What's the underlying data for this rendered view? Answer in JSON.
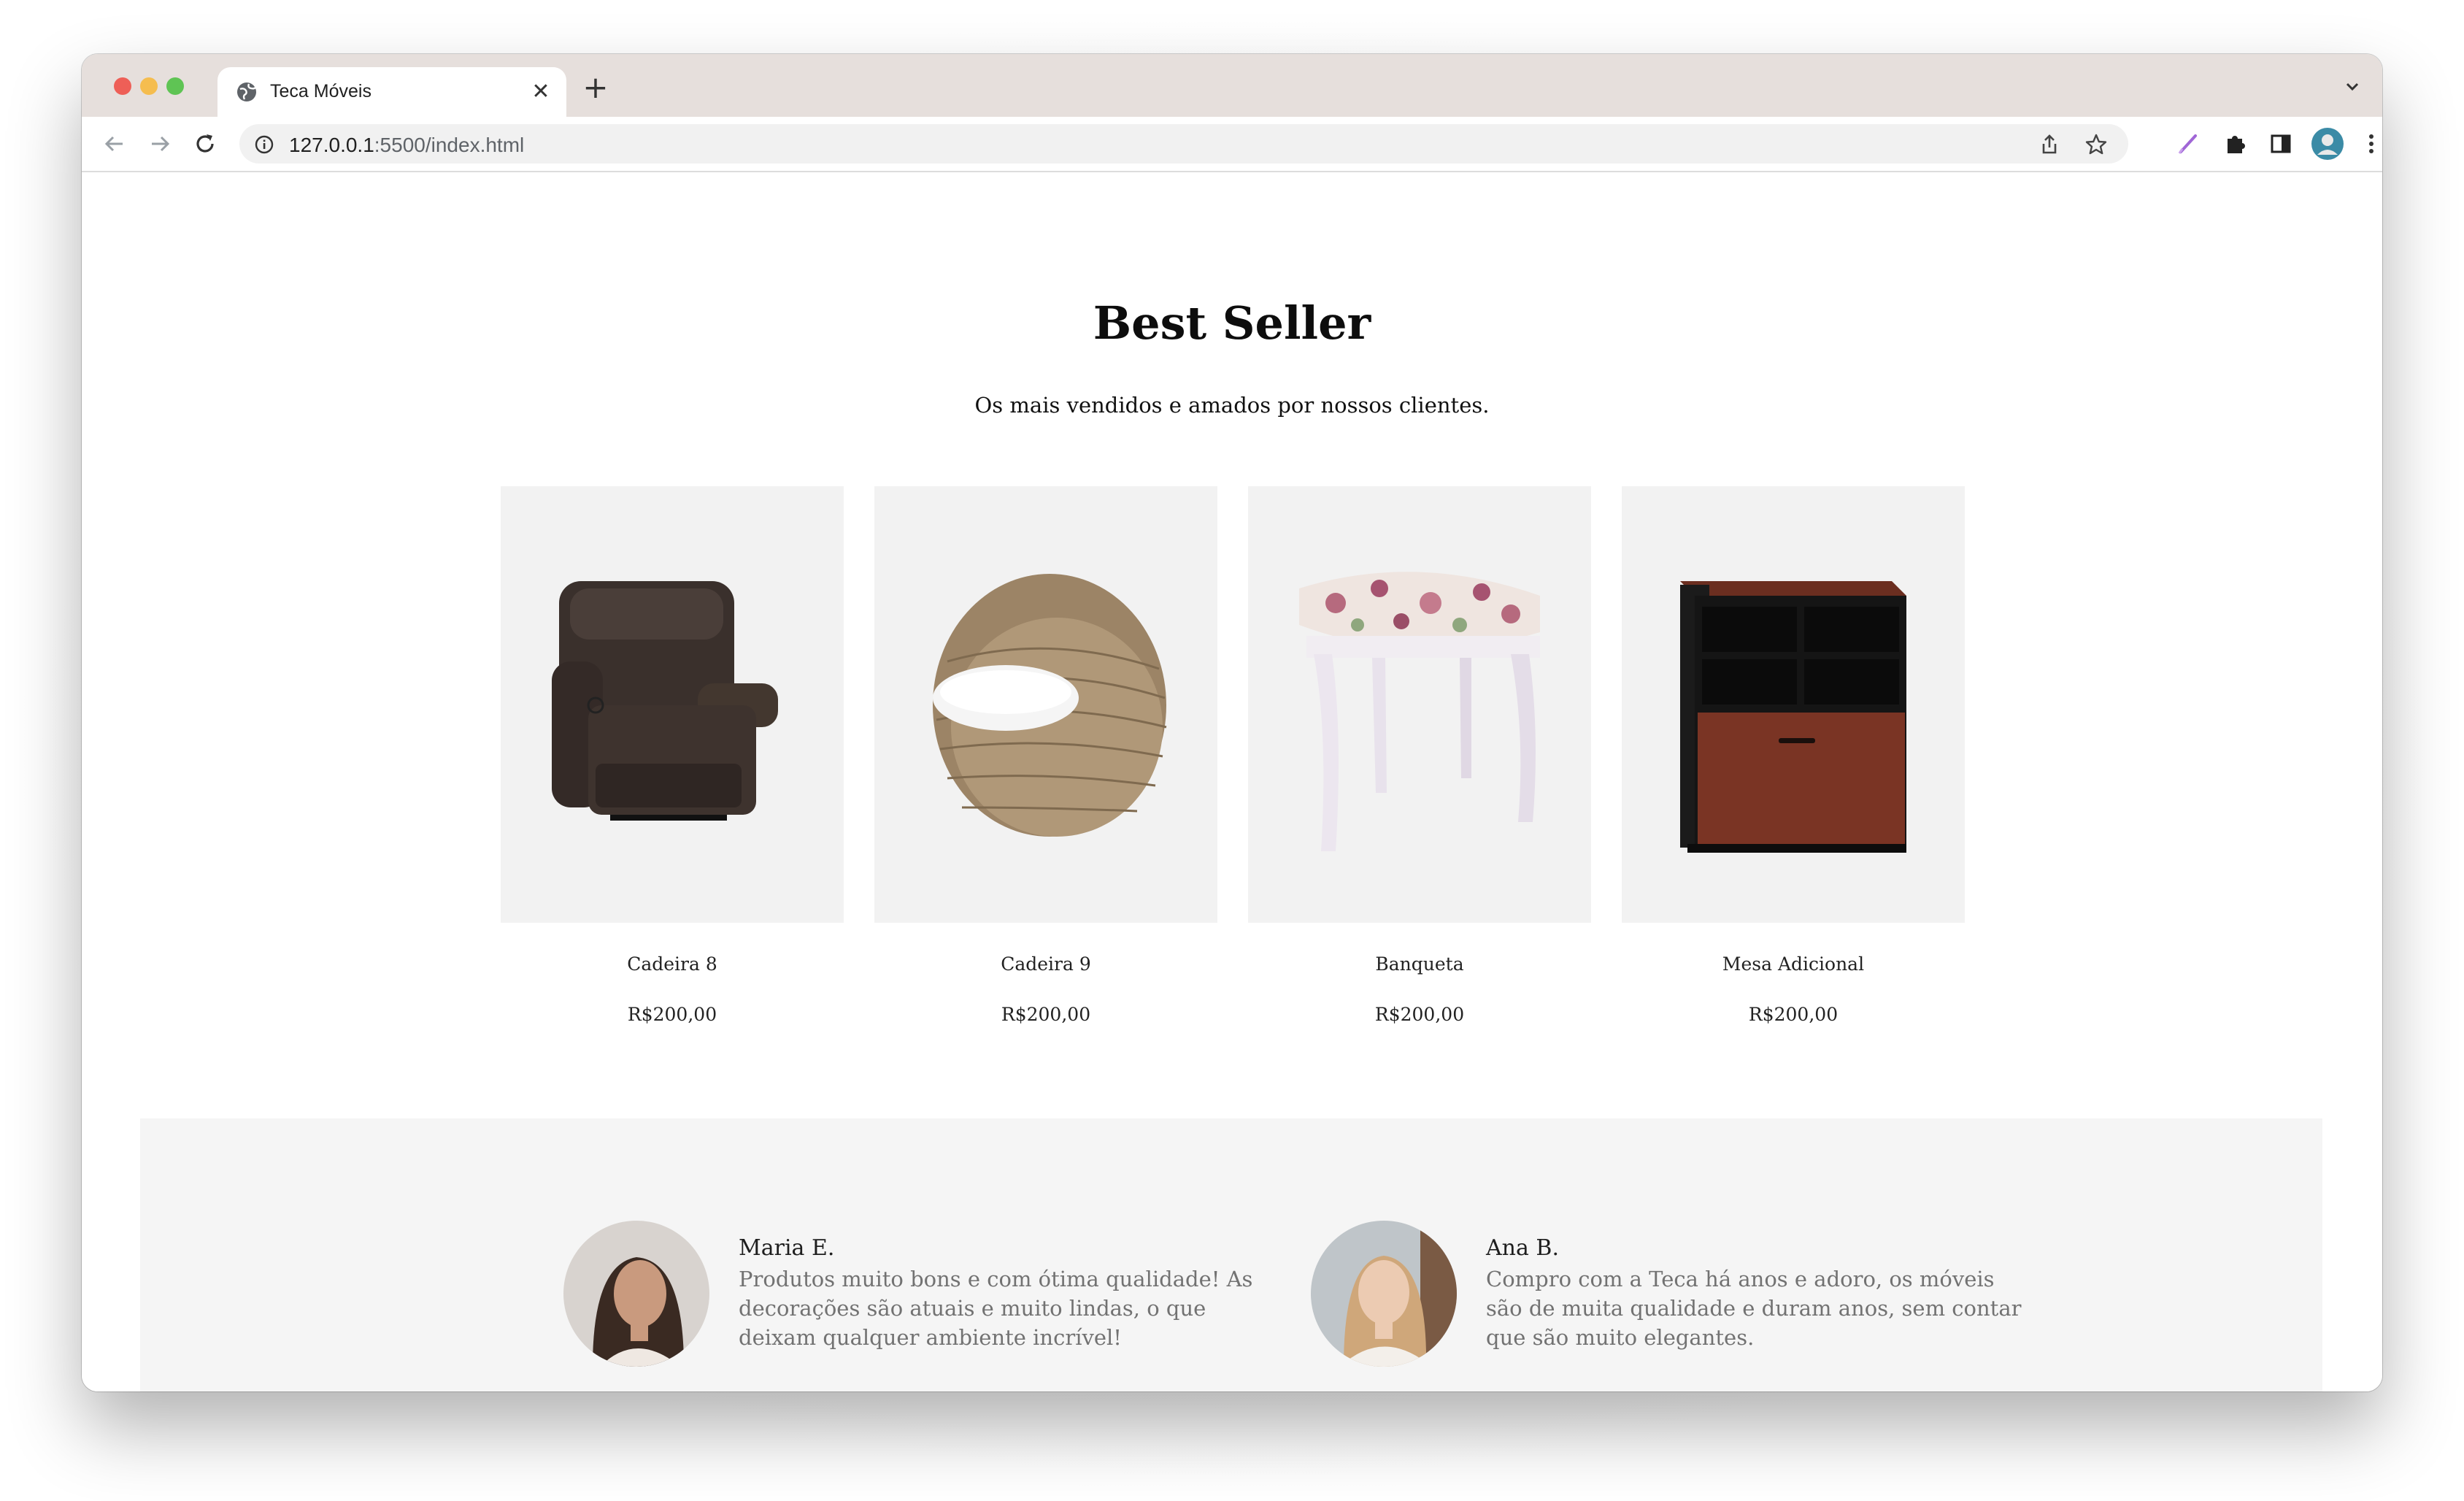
{
  "browser": {
    "tab_title": "Teca Móveis",
    "url_host": "127.0.0.1",
    "url_path": ":5500/index.html"
  },
  "section": {
    "title": "Best Seller",
    "subtitle": "Os mais vendidos e amados por nossos clientes."
  },
  "products": [
    {
      "name": "Cadeira 8",
      "price": "R$200,00",
      "image": "brown-recliner-armchair"
    },
    {
      "name": "Cadeira 9",
      "price": "R$200,00",
      "image": "wicker-egg-chair"
    },
    {
      "name": "Banqueta",
      "price": "R$200,00",
      "image": "floral-cushion-stool"
    },
    {
      "name": "Mesa Adicional",
      "price": "R$200,00",
      "image": "wood-file-cabinet"
    }
  ],
  "testimonials": [
    {
      "name": "Maria E.",
      "text": "Produtos muito bons e com ótima qualidade! As decorações são atuais e muito lindas, o que deixam qualquer ambiente incrível!"
    },
    {
      "name": "Ana B.",
      "text": "Compro com a Teca há anos e adoro, os móveis são de muita qualidade e duram anos, sem contar que são muito elegantes."
    }
  ],
  "icons": {
    "back": "arrow-left-icon",
    "forward": "arrow-right-icon",
    "reload": "reload-icon",
    "info": "info-icon",
    "share": "share-icon",
    "bookmark": "star-icon",
    "extension_pen": "pen-icon",
    "extensions": "puzzle-icon",
    "side_panel": "side-panel-icon",
    "profile": "profile-avatar-icon",
    "menu": "kebab-menu-icon"
  },
  "colors": {
    "tabstrip": "#e6dfdc",
    "card_bg": "#f2f2f2",
    "testimonial_bg": "#f5f5f5",
    "testimonial_text": "#727272"
  }
}
